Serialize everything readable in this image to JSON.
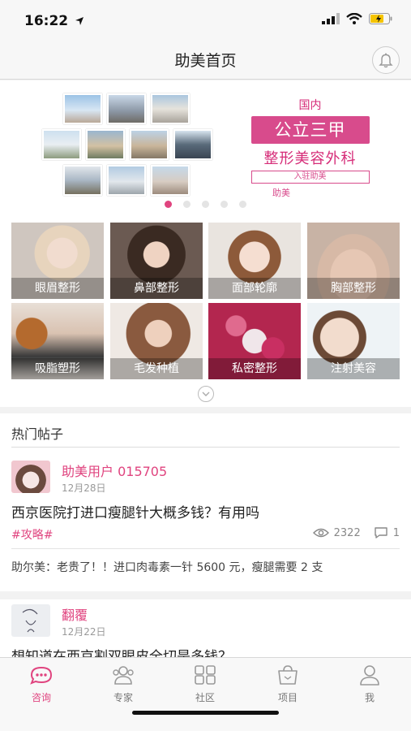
{
  "status": {
    "time": "16:22"
  },
  "nav": {
    "title": "助美首页"
  },
  "banner": {
    "line1": "国内",
    "line2": "公立三甲",
    "line3": "整形美容外科",
    "line4": "入驻助美",
    "logo": "助美",
    "active_dot": 0,
    "dot_count": 5
  },
  "categories": [
    {
      "label": "眼眉整形"
    },
    {
      "label": "鼻部整形"
    },
    {
      "label": "面部轮廓"
    },
    {
      "label": "胸部整形"
    },
    {
      "label": "吸脂塑形"
    },
    {
      "label": "毛发种植"
    },
    {
      "label": "私密整形"
    },
    {
      "label": "注射美容"
    }
  ],
  "hot": {
    "title": "热门帖子",
    "posts": [
      {
        "user": "助美用户 015705",
        "date": "12月28日",
        "title": "西京医院打进口瘦腿针大概多钱？有用吗",
        "tag": "#攻略#",
        "views": "2322",
        "comments": "1",
        "comment": "助尔美：老贵了！！进口肉毒素一针 5600 元，瘦腿需要 2 支"
      },
      {
        "user": "翻覆",
        "date": "12月22日",
        "title": "想知道在西京割双眼皮全切是多钱？"
      }
    ]
  },
  "tabs": [
    {
      "label": "咨询"
    },
    {
      "label": "专家"
    },
    {
      "label": "社区"
    },
    {
      "label": "项目"
    },
    {
      "label": "我"
    }
  ],
  "colors": {
    "accent": "#e0447f",
    "banner_box": "#d84b8c"
  }
}
